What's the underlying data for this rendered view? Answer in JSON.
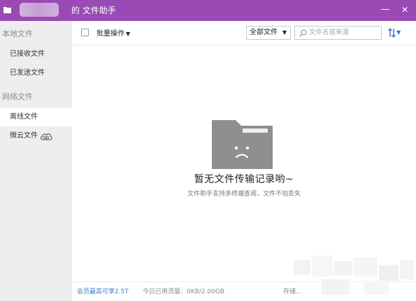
{
  "window": {
    "title": "的 文件助手",
    "minimize_glyph": "—",
    "close_glyph": "✕"
  },
  "sidebar": {
    "local_section": "本地文件",
    "local_items": [
      {
        "label": "已接收文件"
      },
      {
        "label": "已发送文件"
      }
    ],
    "network_section": "网络文件",
    "network_items": [
      {
        "label": "离线文件",
        "selected": true
      },
      {
        "label": "微云文件",
        "icon": "cloud-icon"
      }
    ]
  },
  "toolbar": {
    "batch_label": "批量操作",
    "filter_value": "全部文件",
    "search_placeholder": "文件名或来源",
    "sort_icon": "sort-icon"
  },
  "empty_state": {
    "icon": "sad-folder-icon",
    "title": "暂无文件传输记录哟~",
    "subtitle": "文件助手支持多终端查阅，文件不怕丢失"
  },
  "statusbar": {
    "vip_text": "会员最高可享2.5T",
    "usage_text": "今日已用流量：0KB/2.00GB",
    "storage_text": "存储..."
  },
  "colors": {
    "titlebar": "#9a4ab5",
    "sidebar": "#eeeeee",
    "link_blue": "#3a7fcf",
    "folder_gray": "#8f8f8f"
  }
}
